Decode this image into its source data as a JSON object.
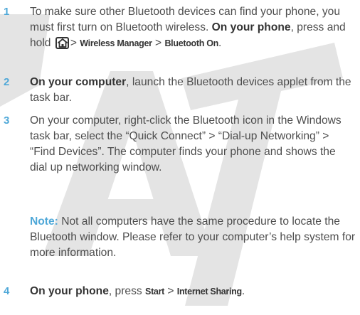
{
  "watermark": {
    "text": "DRAFT"
  },
  "steps": [
    {
      "number": "1",
      "p1": "To make sure other Bluetooth devices can find your phone, you must first turn on Bluetooth wireless. ",
      "bold1": "On your phone",
      "p2": ", press and hold ",
      "icon": "home-key-icon",
      "p3": "> ",
      "menu1": "Wireless Manager",
      "p4": " > ",
      "menu2": "Bluetooth On",
      "p5": "."
    },
    {
      "number": "2",
      "bold1": "On your computer",
      "p1": ", launch the Bluetooth devices applet from the task bar."
    },
    {
      "number": "3",
      "p1": "On your computer, right-click the Bluetooth icon in the Windows task bar, select the “Quick Connect” > “Dial-up Networking” > “Find Devices”. The computer finds your phone and shows the dial up networking window."
    },
    {
      "number": "4",
      "bold1": "On your phone",
      "p1": ", press ",
      "menu1": "Start",
      "p2": " > ",
      "menu2": "Internet Sharing",
      "p3": "."
    }
  ],
  "note": {
    "label": "Note:",
    "text": " Not all computers have the same procedure to locate the Bluetooth window. Please refer to your computer’s help system for more information."
  }
}
